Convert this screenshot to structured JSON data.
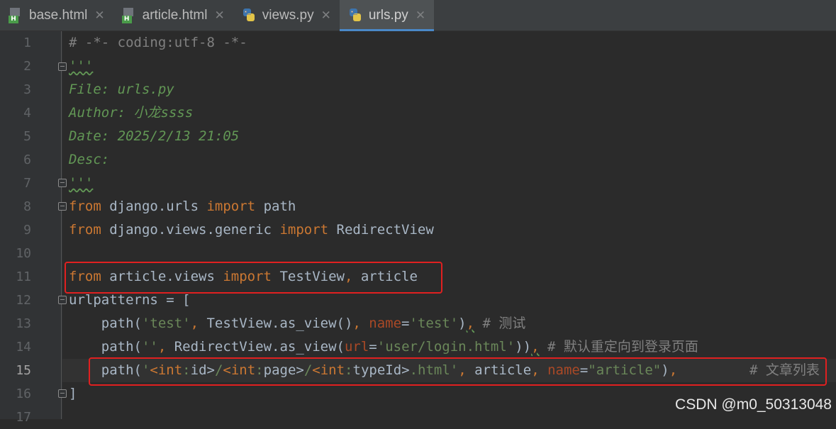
{
  "tabs": [
    {
      "label": "base.html",
      "icon": "html-file-icon",
      "active": false
    },
    {
      "label": "article.html",
      "icon": "html-file-icon",
      "active": false
    },
    {
      "label": "views.py",
      "icon": "python-file-icon",
      "active": false
    },
    {
      "label": "urls.py",
      "icon": "python-file-icon",
      "active": true
    }
  ],
  "close_glyph": "✕",
  "line_numbers": [
    "1",
    "2",
    "3",
    "4",
    "5",
    "6",
    "7",
    "8",
    "9",
    "10",
    "11",
    "12",
    "13",
    "14",
    "15",
    "16",
    "17"
  ],
  "current_line": "15",
  "code": {
    "l1": "# -*- coding:utf-8 -*-",
    "l2": "'''",
    "l3": "File: urls.py",
    "l4": "Author: 小龙ssss",
    "l5": "Date: 2025/2/13 21:05",
    "l6": "Desc:",
    "l7": "'''",
    "l8_kw1": "from",
    "l8_mod": " django.urls ",
    "l8_kw2": "import",
    "l8_name": " path",
    "l9_kw1": "from",
    "l9_mod": " django.views.generic ",
    "l9_kw2": "import",
    "l9_name": " RedirectView",
    "l11_kw1": "from",
    "l11_mod": " article.views ",
    "l11_kw2": "import",
    "l11_name1": " TestView",
    "l11_comma": ",",
    "l11_name2": " article",
    "l12": "urlpatterns = [",
    "l13_a": "    path(",
    "l13_s1": "'test'",
    "l13_c": ",",
    "l13_b": " TestView.as_view()",
    "l13_c2": ", ",
    "l13_p": "name",
    "l13_eq": "=",
    "l13_s2": "'test'",
    "l13_e": ")",
    "l13_c3": ",",
    "l13_cmt": " # 测试",
    "l14_a": "    path(",
    "l14_s1": "''",
    "l14_c": ",",
    "l14_b": " RedirectView.as_view(",
    "l14_p": "url",
    "l14_eq": "=",
    "l14_s2": "'user/login.html'",
    "l14_e": "))",
    "l14_c2": ",",
    "l14_cmt": " # 默认重定向到登录页面",
    "l15_a": "    path(",
    "l15_q1": "'",
    "l15_f1": "<int",
    "l15_f1c": ":",
    "l15_f1n": "id>",
    "l15_sl1": "/",
    "l15_f2": "<int",
    "l15_f2c": ":",
    "l15_f2n": "page>",
    "l15_sl2": "/",
    "l15_f3": "<int",
    "l15_f3c": ":",
    "l15_f3n": "typeId>",
    "l15_tail": ".html'",
    "l15_c": ",",
    "l15_b": " article",
    "l15_c2": ", ",
    "l15_p": "name",
    "l15_eq": "=",
    "l15_s2": "\"article\"",
    "l15_e": ")",
    "l15_c3": ",",
    "l15_cmt": "# 文章列表",
    "l16": "]"
  },
  "watermark": "CSDN @m0_50313048",
  "colors": {
    "keyword": "#cc7832",
    "string": "#6a8759",
    "comment": "#808080",
    "highlight_box": "#e02020",
    "active_tab_underline": "#4a88c7"
  }
}
